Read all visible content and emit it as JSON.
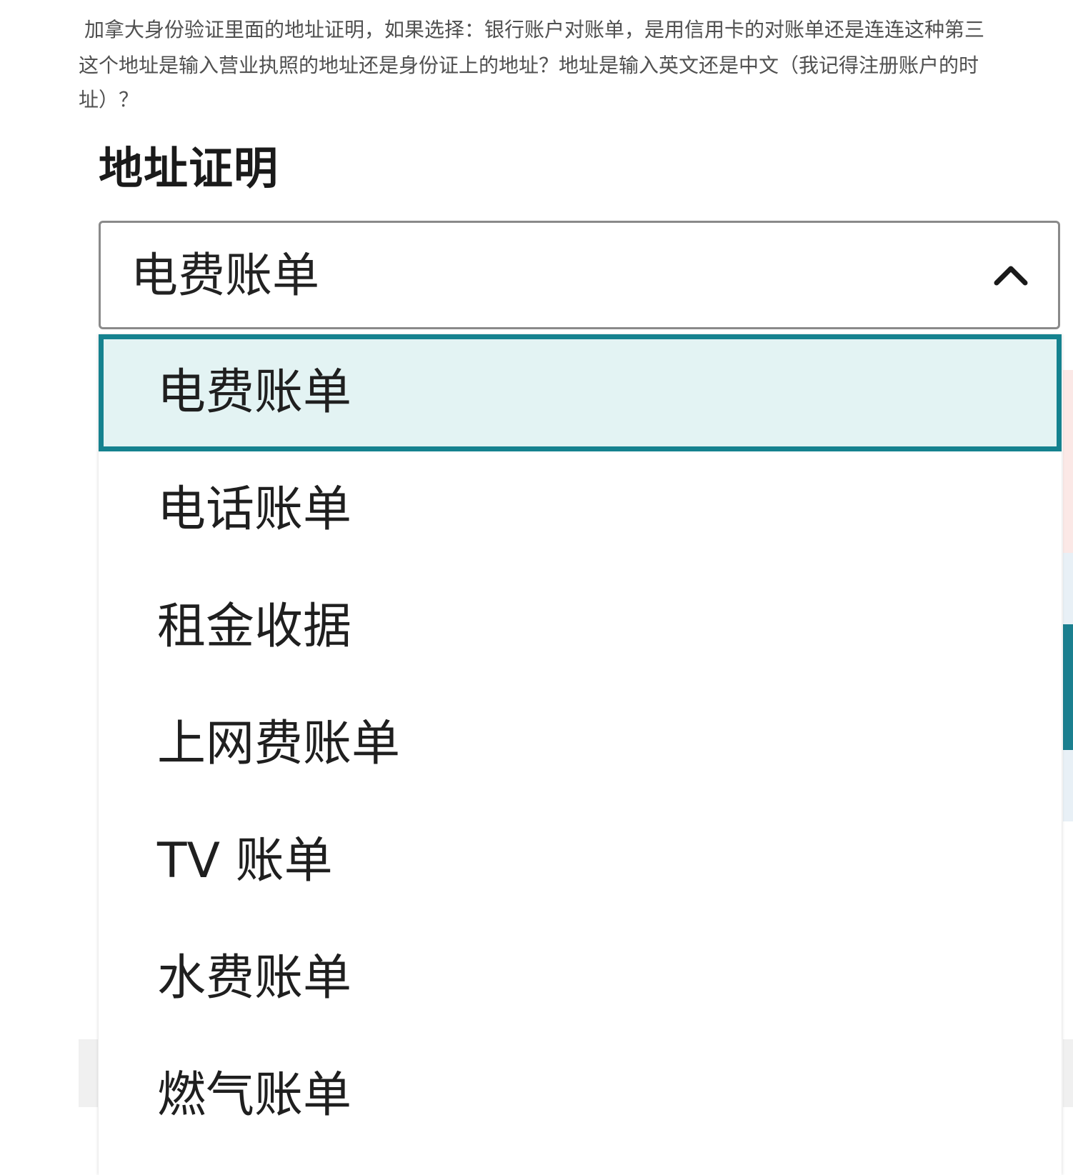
{
  "question": {
    "line1": "加拿大身份验证里面的地址证明，如果选择：银行账户对账单，是用信用卡的对账单还是连连这种第三",
    "line2": "这个地址是输入营业执照的地址还是身份证上的地址？地址是输入英文还是中文（我记得注册账户的时",
    "line3": "址）？"
  },
  "form": {
    "label": "地址证明",
    "select": {
      "selected_value": "电费账单",
      "expanded": true,
      "options": [
        {
          "label": "电费账单",
          "selected": true
        },
        {
          "label": "电话账单",
          "selected": false
        },
        {
          "label": "租金收据",
          "selected": false
        },
        {
          "label": "上网费账单",
          "selected": false
        },
        {
          "label": "TV 账单",
          "selected": false
        },
        {
          "label": "水费账单",
          "selected": false
        },
        {
          "label": "燃气账单",
          "selected": false
        }
      ]
    }
  },
  "icons": {
    "select_toggle": "chevron-up-icon"
  },
  "colors": {
    "selected_border": "#15828f",
    "selected_background": "#e3f3f3",
    "select_border": "#8a8a8a",
    "question_text": "#505050"
  }
}
